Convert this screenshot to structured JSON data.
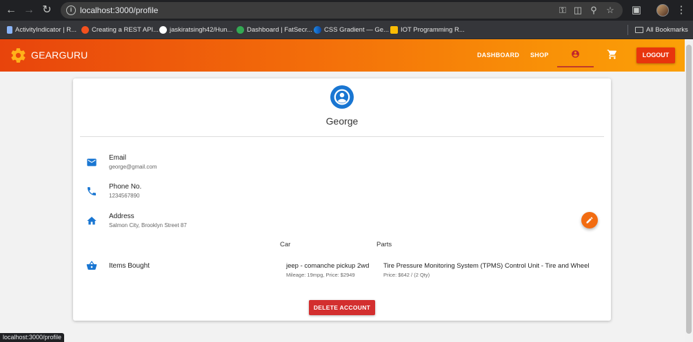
{
  "browser": {
    "url": "localhost:3000/profile",
    "bookmarks": [
      {
        "label": "ActivityIndicator | R...",
        "color": "#8ab4f8"
      },
      {
        "label": "Creating a REST API...",
        "color": "#f4511e"
      },
      {
        "label": "jaskiratsingh42/Hun...",
        "color": "#ffffff"
      },
      {
        "label": "Dashboard | FatSecr...",
        "color": "#34a853"
      },
      {
        "label": "CSS Gradient — Ge...",
        "color": "#1e88e5"
      },
      {
        "label": "IOT Programming R...",
        "color": "#fbbc04"
      }
    ],
    "all_bookmarks": "All Bookmarks",
    "status_url": "localhost:3000/profile"
  },
  "header": {
    "brand": "GEARGURU",
    "nav": {
      "dashboard": "DASHBOARD",
      "shop": "SHOP"
    },
    "logout": "LOGOUT",
    "accent": "#f36d0a"
  },
  "profile": {
    "name": "George",
    "email_label": "Email",
    "email": "george@gmail.com",
    "phone_label": "Phone No.",
    "phone": "1234567890",
    "address_label": "Address",
    "address": "Salmon City, Brooklyn Street 87",
    "items_label": "Items Bought",
    "car_header": "Car",
    "parts_header": "Parts",
    "car_item": {
      "title": "jeep - comanche pickup 2wd",
      "detail": "Mileage: 19mpg, Price: $2949"
    },
    "part_item": {
      "title": "Tire Pressure Monitoring System (TPMS) Control Unit - Tire and Wheel",
      "detail": "Price: $642 / (2 Qty)"
    },
    "delete": "DELETE ACCOUNT",
    "icon_color": "#1976d2"
  }
}
